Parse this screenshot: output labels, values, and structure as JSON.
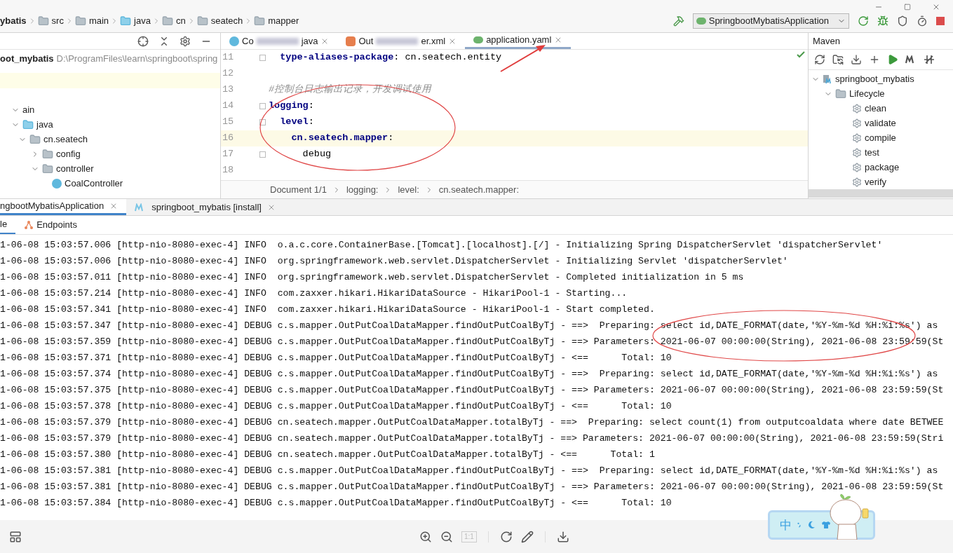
{
  "title_bar": {
    "breadcrumbs": [
      "ybatis",
      "src",
      "main",
      "java",
      "cn",
      "seatech",
      "mapper"
    ],
    "run_config": "SpringbootMybatisApplication"
  },
  "project": {
    "root": {
      "label": "oot_mybatis",
      "path": "D:\\ProgramFiles\\learn\\springboot\\spring"
    },
    "tree": [
      {
        "label": "ain",
        "expanded": true,
        "children": [
          {
            "label": "java",
            "kind": "source",
            "expanded": true,
            "children": [
              {
                "label": "cn.seatech",
                "kind": "package",
                "expanded": true,
                "children": [
                  {
                    "label": "config",
                    "kind": "package",
                    "expanded": false
                  },
                  {
                    "label": "controller",
                    "kind": "package",
                    "expanded": true,
                    "children": [
                      {
                        "label": "CoalController",
                        "kind": "class"
                      }
                    ]
                  }
                ]
              }
            ]
          }
        ]
      }
    ]
  },
  "editor": {
    "tabs": [
      {
        "start": "Co",
        "end": "java",
        "kind": "java",
        "selected": false
      },
      {
        "start": "Out",
        "end": "er.xml",
        "kind": "xml",
        "selected": false
      },
      {
        "start": "application.yaml",
        "kind": "yaml",
        "selected": true
      }
    ],
    "lines": [
      {
        "number": "11",
        "key": "  type-aliases-package",
        "sep": ":",
        "value": " cn.seatech.entity",
        "fold": true,
        "current": false
      },
      {
        "number": "12",
        "fold": false,
        "current": false
      },
      {
        "number": "13",
        "comment": "#控制台日志输出记录，开发调试使用",
        "fold": false,
        "current": false
      },
      {
        "number": "14",
        "key": "logging",
        "sep": ":",
        "fold": true,
        "current": false
      },
      {
        "number": "15",
        "key": "  level",
        "sep": ":",
        "fold": true,
        "current": false
      },
      {
        "number": "16",
        "key": "    cn.seatech.mapper",
        "sep": ":",
        "fold": false,
        "current": true
      },
      {
        "number": "17",
        "value": "      debug",
        "fold": true,
        "current": false
      },
      {
        "number": "18",
        "fold": false,
        "current": false
      }
    ],
    "breadcrumbs": [
      "Document 1/1",
      "logging:",
      "level:",
      "cn.seatech.mapper:"
    ]
  },
  "maven": {
    "title": "Maven",
    "project": "springboot_mybatis",
    "lifecycle": "Lifecycle",
    "goals": [
      "clean",
      "validate",
      "compile",
      "test",
      "package",
      "verify"
    ]
  },
  "run": {
    "tabs": [
      {
        "label": "ngbootMybatisApplication",
        "selected": true
      },
      {
        "label": "springboot_mybatis [install]",
        "kind": "maven",
        "selected": false
      }
    ],
    "subtabs": [
      {
        "label": "le",
        "kind": "console",
        "selected": true
      },
      {
        "label": "Endpoints",
        "kind": "endpoints",
        "selected": false
      }
    ],
    "log": [
      "1-06-08 15:03:57.006 [http-nio-8080-exec-4] INFO  o.a.c.core.ContainerBase.[Tomcat].[localhost].[/] - Initializing Spring DispatcherServlet 'dispatcherServlet'",
      "1-06-08 15:03:57.006 [http-nio-8080-exec-4] INFO  org.springframework.web.servlet.DispatcherServlet - Initializing Servlet 'dispatcherServlet'",
      "1-06-08 15:03:57.011 [http-nio-8080-exec-4] INFO  org.springframework.web.servlet.DispatcherServlet - Completed initialization in 5 ms",
      "1-06-08 15:03:57.214 [http-nio-8080-exec-4] INFO  com.zaxxer.hikari.HikariDataSource - HikariPool-1 - Starting...",
      "1-06-08 15:03:57.341 [http-nio-8080-exec-4] INFO  com.zaxxer.hikari.HikariDataSource - HikariPool-1 - Start completed.",
      "1-06-08 15:03:57.347 [http-nio-8080-exec-4] DEBUG c.s.mapper.OutPutCoalDataMapper.findOutPutCoalByTj - ==>  Preparing: select id,DATE_FORMAT(date,'%Y-%m-%d %H:%i:%s') as",
      "1-06-08 15:03:57.359 [http-nio-8080-exec-4] DEBUG c.s.mapper.OutPutCoalDataMapper.findOutPutCoalByTj - ==> Parameters: 2021-06-07 00:00:00(String), 2021-06-08 23:59:59(St",
      "1-06-08 15:03:57.371 [http-nio-8080-exec-4] DEBUG c.s.mapper.OutPutCoalDataMapper.findOutPutCoalByTj - <==      Total: 10",
      "1-06-08 15:03:57.374 [http-nio-8080-exec-4] DEBUG c.s.mapper.OutPutCoalDataMapper.findOutPutCoalByTj - ==>  Preparing: select id,DATE_FORMAT(date,'%Y-%m-%d %H:%i:%s') as",
      "1-06-08 15:03:57.375 [http-nio-8080-exec-4] DEBUG c.s.mapper.OutPutCoalDataMapper.findOutPutCoalByTj - ==> Parameters: 2021-06-07 00:00:00(String), 2021-06-08 23:59:59(St",
      "1-06-08 15:03:57.378 [http-nio-8080-exec-4] DEBUG c.s.mapper.OutPutCoalDataMapper.findOutPutCoalByTj - <==      Total: 10",
      "1-06-08 15:03:57.379 [http-nio-8080-exec-4] DEBUG cn.seatech.mapper.OutPutCoalDataMapper.totalByTj - ==>  Preparing: select count(1) from outputcoaldata where date BETWEE",
      "1-06-08 15:03:57.379 [http-nio-8080-exec-4] DEBUG cn.seatech.mapper.OutPutCoalDataMapper.totalByTj - ==> Parameters: 2021-06-07 00:00:00(String), 2021-06-08 23:59:59(Stri",
      "1-06-08 15:03:57.380 [http-nio-8080-exec-4] DEBUG cn.seatech.mapper.OutPutCoalDataMapper.totalByTj - <==      Total: 1",
      "1-06-08 15:03:57.381 [http-nio-8080-exec-4] DEBUG c.s.mapper.OutPutCoalDataMapper.findOutPutCoalByTj - ==>  Preparing: select id,DATE_FORMAT(date,'%Y-%m-%d %H:%i:%s') as",
      "1-06-08 15:03:57.381 [http-nio-8080-exec-4] DEBUG c.s.mapper.OutPutCoalDataMapper.findOutPutCoalByTj - ==> Parameters: 2021-06-07 00:00:00(String), 2021-06-08 23:59:59(St",
      "1-06-08 15:03:57.384 [http-nio-8080-exec-4] DEBUG c.s.mapper.OutPutCoalDataMapper.findOutPutCoalByTj - <==      Total: 10"
    ]
  },
  "ime": {
    "mode": "中"
  },
  "viewer": {
    "actual_size": "1:1"
  }
}
